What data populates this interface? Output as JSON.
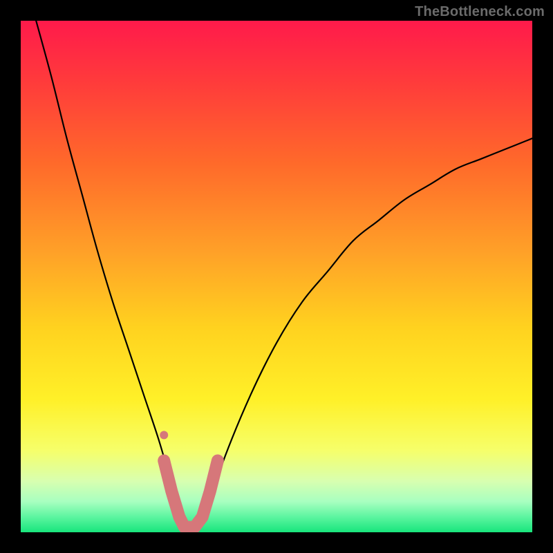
{
  "watermark": "TheBottleneck.com",
  "chart_data": {
    "type": "line",
    "title": "",
    "xlabel": "",
    "ylabel": "",
    "xlim": [
      0,
      100
    ],
    "ylim": [
      0,
      100
    ],
    "grid": false,
    "legend": false,
    "background_gradient": {
      "direction": "top-to-bottom",
      "stops": [
        {
          "pos": 0.0,
          "color": "#ff1a4b"
        },
        {
          "pos": 0.12,
          "color": "#ff3b3b"
        },
        {
          "pos": 0.28,
          "color": "#ff6a2a"
        },
        {
          "pos": 0.45,
          "color": "#ffa028"
        },
        {
          "pos": 0.6,
          "color": "#ffd21f"
        },
        {
          "pos": 0.74,
          "color": "#fff028"
        },
        {
          "pos": 0.84,
          "color": "#f6ff6a"
        },
        {
          "pos": 0.9,
          "color": "#d8ffb0"
        },
        {
          "pos": 0.94,
          "color": "#a8ffc0"
        },
        {
          "pos": 0.97,
          "color": "#5cf5a0"
        },
        {
          "pos": 1.0,
          "color": "#18e57c"
        }
      ]
    },
    "series": [
      {
        "name": "bottleneck-curve",
        "x": [
          3,
          6,
          9,
          12,
          15,
          18,
          21,
          24,
          27,
          29,
          30,
          31,
          32,
          33,
          34,
          35,
          37,
          40,
          45,
          50,
          55,
          60,
          65,
          70,
          75,
          80,
          85,
          90,
          95,
          100
        ],
        "y": [
          100,
          89,
          77,
          66,
          55,
          45,
          36,
          27,
          18,
          11,
          7,
          3,
          0,
          0,
          0,
          1,
          6,
          15,
          27,
          37,
          45,
          51,
          57,
          61,
          65,
          68,
          71,
          73,
          75,
          77
        ]
      }
    ],
    "highlight_band": {
      "name": "optimal-range",
      "color": "#d6777a",
      "points": [
        {
          "x": 28.0,
          "y": 14
        },
        {
          "x": 29.5,
          "y": 8
        },
        {
          "x": 31.0,
          "y": 3
        },
        {
          "x": 32.0,
          "y": 1
        },
        {
          "x": 33.0,
          "y": 1
        },
        {
          "x": 34.0,
          "y": 1
        },
        {
          "x": 35.5,
          "y": 3
        },
        {
          "x": 37.0,
          "y": 8
        },
        {
          "x": 38.5,
          "y": 14
        }
      ],
      "outlier": {
        "x": 28.0,
        "y": 19
      }
    }
  }
}
